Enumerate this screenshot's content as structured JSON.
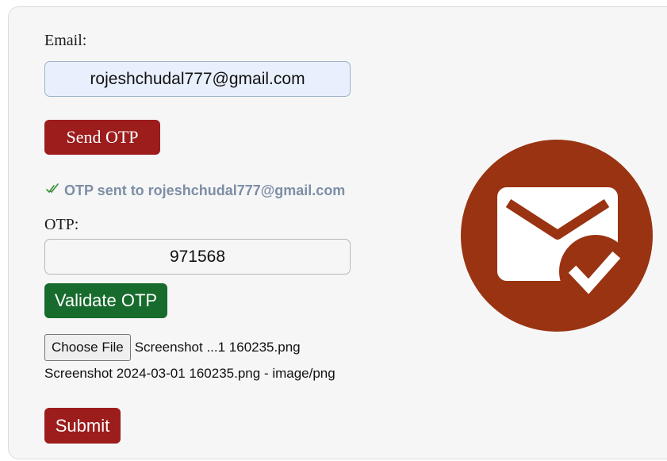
{
  "form": {
    "email_label": "Email:",
    "email_value": "rojeshchudal777@gmail.com",
    "send_otp_label": "Send OTP",
    "otp_status_icon": "double-check-icon",
    "otp_status_text": "OTP sent to rojeshchudal777@gmail.com",
    "otp_label": "OTP:",
    "otp_value": "971568",
    "validate_otp_label": "Validate OTP",
    "choose_file_label": "Choose File",
    "chosen_file_name": "Screenshot ...1 160235.png",
    "file_info": "Screenshot 2024-03-01 160235.png - image/png",
    "submit_label": "Submit"
  },
  "illustration": {
    "icon": "mail-verified-icon",
    "circle_color": "#993311",
    "envelope_color": "#ffffff"
  },
  "colors": {
    "send_button": "#9d1d1d",
    "validate_button": "#176b2c",
    "submit_button": "#9d1d1d",
    "status_text": "#7d8ea6",
    "status_check": "#3a8f3a",
    "email_field_bg": "#e8f0fe"
  }
}
